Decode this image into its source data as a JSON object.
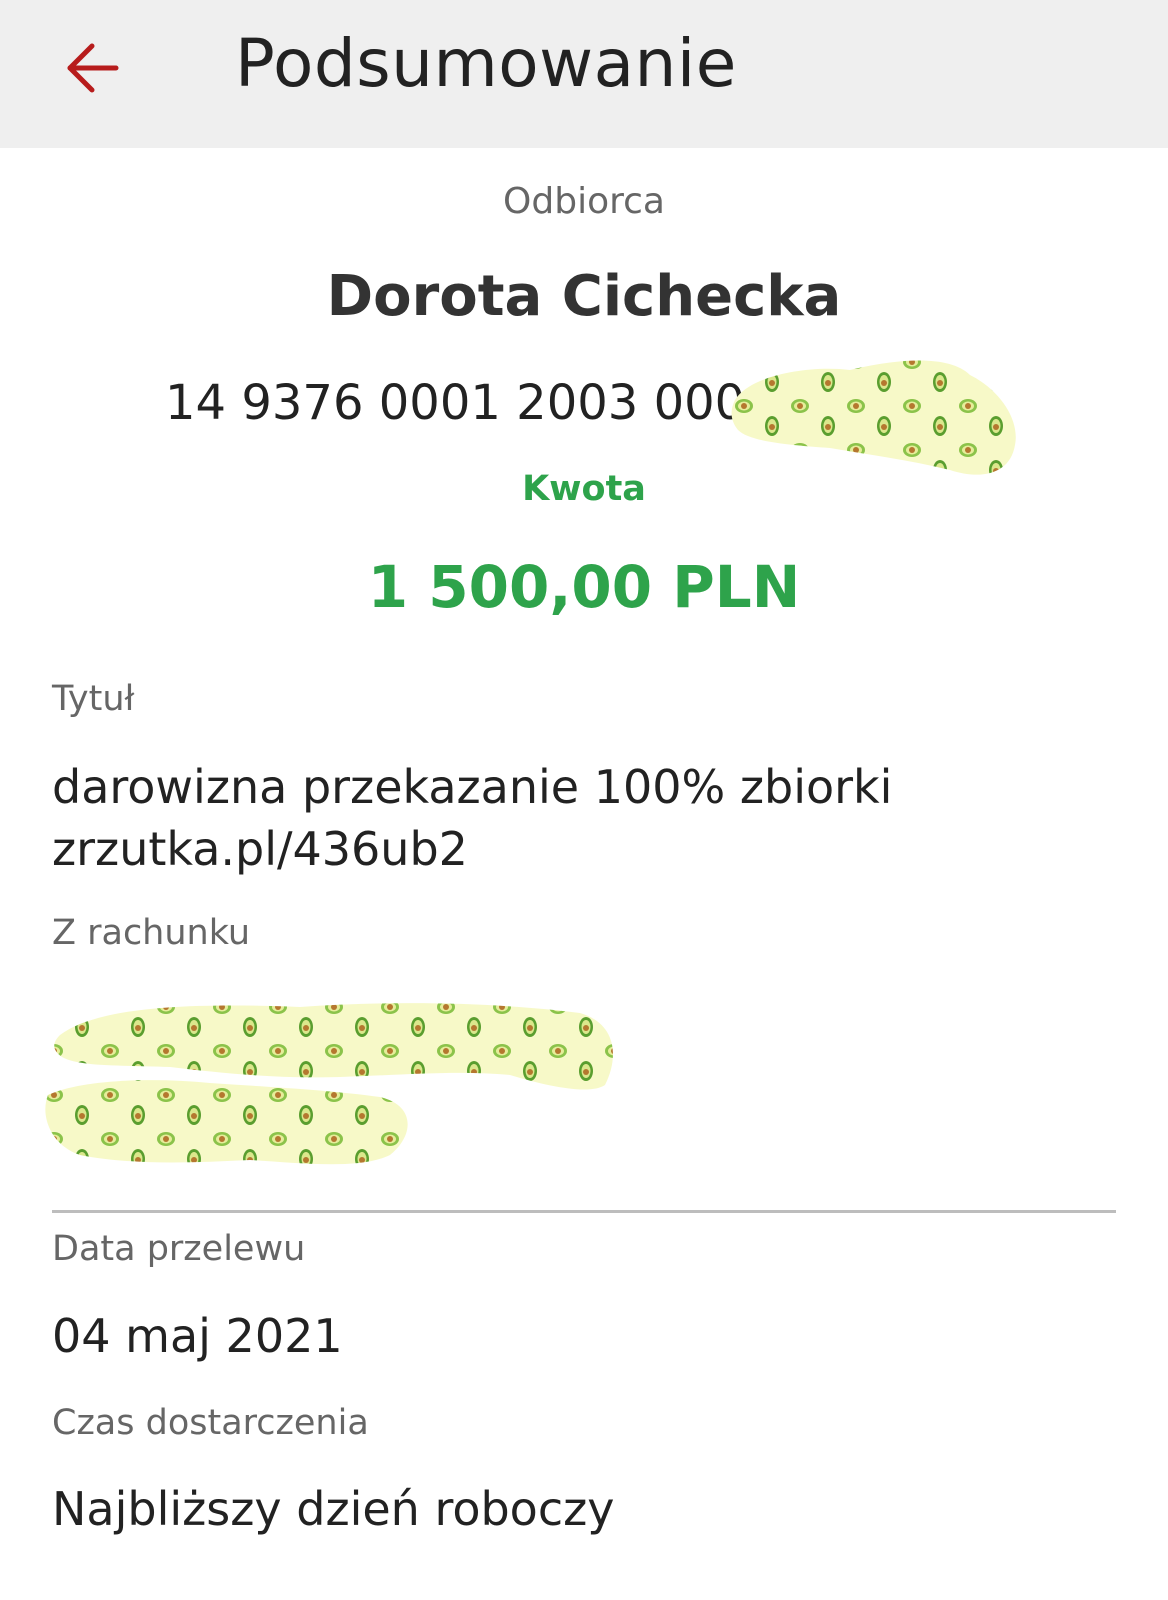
{
  "header": {
    "title": "Podsumowanie",
    "back_icon": "arrow-left-icon",
    "accent_color": "#b71c1c"
  },
  "recipient": {
    "label": "Odbiorca",
    "name": "Dorota Cichecka",
    "account_visible": "14 9376 0001 2003 0000"
  },
  "amount": {
    "label": "Kwota",
    "value": "1 500,00 PLN",
    "color": "#2ea34b"
  },
  "title_field": {
    "label": "Tytuł",
    "value_line1": "darowizna przekazanie 100% zbiorki",
    "value_line2": "zrzutka.pl/436ub2"
  },
  "from_account": {
    "label": "Z rachunku"
  },
  "transfer_date": {
    "label": "Data przelewu",
    "value": "04 maj 2021"
  },
  "delivery_time": {
    "label": "Czas dostarczenia",
    "value": "Najbliższy dzień roboczy"
  }
}
